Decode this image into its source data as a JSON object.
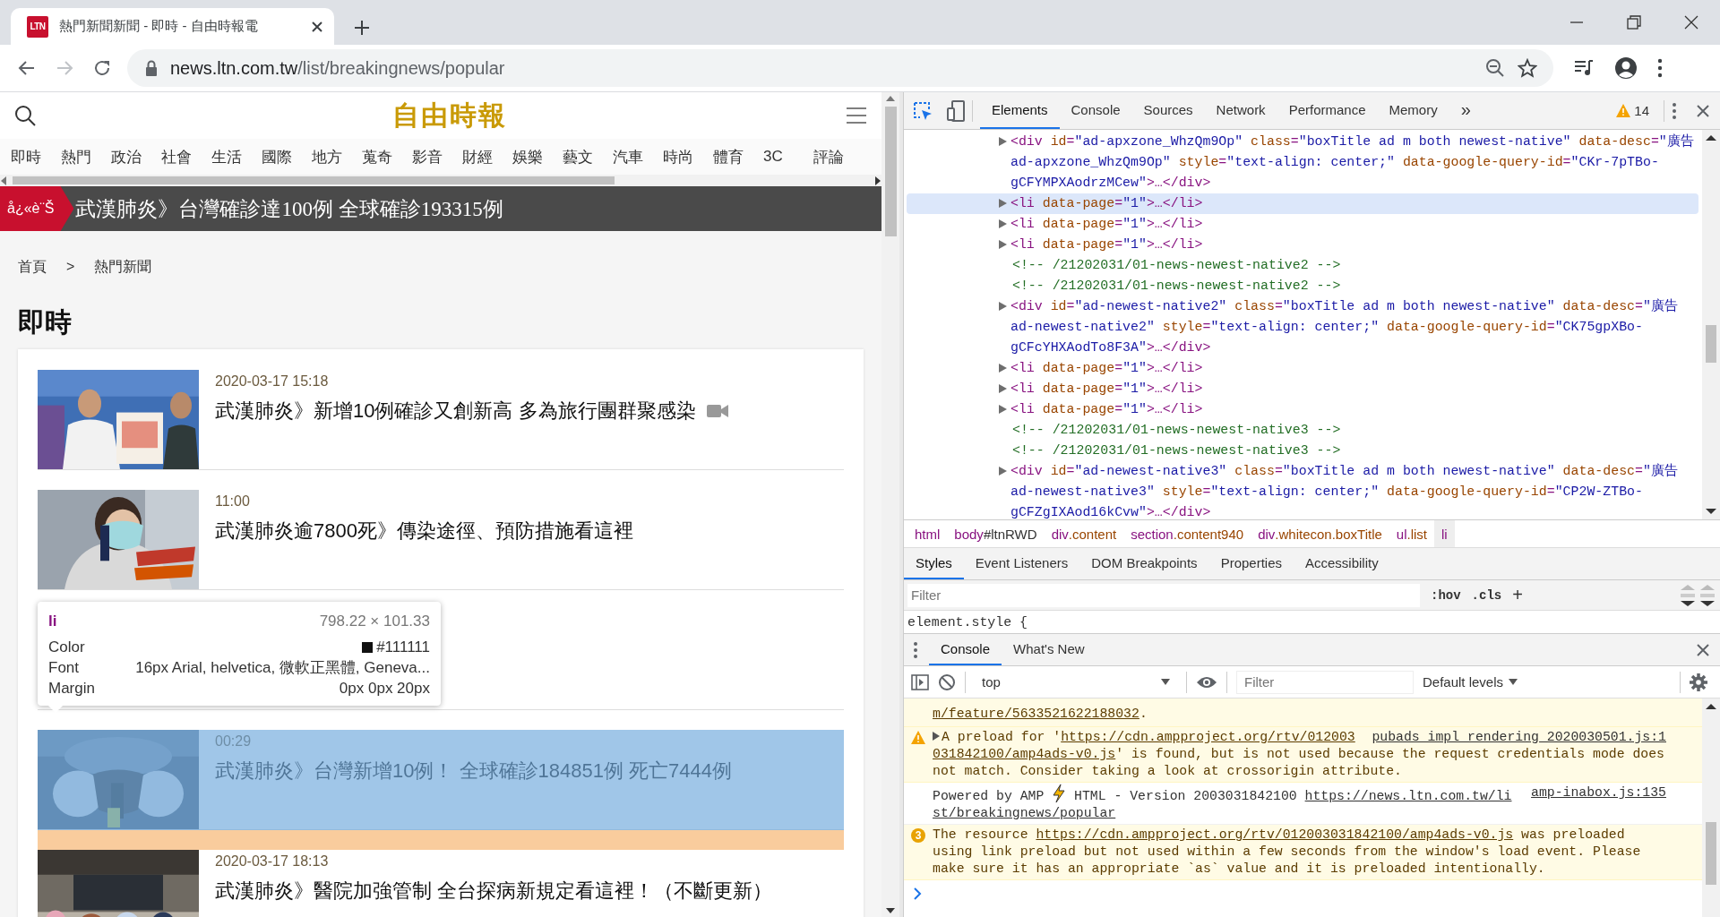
{
  "browser": {
    "favicon": "LTN",
    "tab_title": "熱門新聞新聞 - 即時 - 自由時報電",
    "url_host": "news.ltn.com.tw",
    "url_path": "/list/breakingnews/popular",
    "forward_disabled": true
  },
  "page": {
    "logo": "自由時報",
    "nav": [
      "即時",
      "熱門",
      "政治",
      "社會",
      "生活",
      "國際",
      "地方",
      "蒐奇",
      "影音",
      "財經",
      "娛樂",
      "藝文",
      "汽車",
      "時尚",
      "體育",
      "3C",
      "評論"
    ],
    "ticker": {
      "badge": "å¿«è¨Š",
      "text": "武漢肺炎》台灣確診達100例 全球確診193315例"
    },
    "breadcrumb": {
      "items": [
        "首頁",
        "熱門新聞"
      ],
      "separator": ">"
    },
    "heading": "即時",
    "articles": [
      {
        "kind": "story",
        "time": "2020-03-17 15:18",
        "title": "武漢肺炎》新增10例確診又創新高 多為旅行團群聚感染",
        "video": true,
        "inspected": false
      },
      {
        "kind": "story",
        "time": "11:00",
        "title": "武漢肺炎逾7800死》傳染途徑、預防措施看這裡",
        "video": false,
        "inspected": false
      },
      {
        "kind": "blank",
        "inspected": false
      },
      {
        "kind": "story",
        "time": "00:29",
        "title": "武漢肺炎》台灣新增10例！ 全球確診184851例 死亡7444例",
        "video": false,
        "inspected": true
      },
      {
        "kind": "story",
        "time": "2020-03-17 18:13",
        "title": "武漢肺炎》醫院加強管制 全台探病新規定看這裡！（不斷更新）",
        "video": false,
        "inspected": false
      }
    ]
  },
  "tooltip": {
    "tag": "li",
    "size": "798.22 × 101.33",
    "rows": [
      {
        "label": "Color",
        "value": "#111111",
        "color": "#111111"
      },
      {
        "label": "Font",
        "value": "16px Arial, helvetica, 微軟正黑體, Geneva..."
      },
      {
        "label": "Margin",
        "value": "0px 0px 20px"
      }
    ]
  },
  "devtools": {
    "inspect_active": true,
    "tabs": [
      {
        "label": "Elements",
        "selected": true
      },
      {
        "label": "Console",
        "selected": false
      },
      {
        "label": "Sources",
        "selected": false
      },
      {
        "label": "Network",
        "selected": false
      },
      {
        "label": "Performance",
        "selected": false
      },
      {
        "label": "Memory",
        "selected": false
      }
    ],
    "more": "»",
    "warnings": "14",
    "dom_lines": [
      {
        "kind": "element",
        "text": "<div id=\"ad-apxzone_WhzQm9Op\" class=\"boxTitle ad m both newest-native\" data-desc=\"廣告ad-apxzone_WhzQm9Op\" style=\"text-align: center;\" data-google-query-id=\"CKr-7pTBo-gCFYMPXAodrzMCew\">…</div>",
        "highlighted": false
      },
      {
        "kind": "element",
        "text": "<li data-page=\"1\">…</li>",
        "highlighted": true
      },
      {
        "kind": "element",
        "text": "<li data-page=\"1\">…</li>",
        "highlighted": false
      },
      {
        "kind": "element",
        "text": "<li data-page=\"1\">…</li>",
        "highlighted": false
      },
      {
        "kind": "comment",
        "text": "<!-- /21202031/01-news-newest-native2 -->",
        "highlighted": false
      },
      {
        "kind": "comment",
        "text": "<!-- /21202031/01-news-newest-native2 -->",
        "highlighted": false
      },
      {
        "kind": "element",
        "text": "<div id=\"ad-newest-native2\" class=\"boxTitle ad m both newest-native\" data-desc=\"廣告ad-newest-native2\" style=\"text-align: center;\" data-google-query-id=\"CK75gpXBo-gCFcYHXAodTo8F3A\">…</div>",
        "highlighted": false
      },
      {
        "kind": "element",
        "text": "<li data-page=\"1\">…</li>",
        "highlighted": false
      },
      {
        "kind": "element",
        "text": "<li data-page=\"1\">…</li>",
        "highlighted": false
      },
      {
        "kind": "element",
        "text": "<li data-page=\"1\">…</li>",
        "highlighted": false
      },
      {
        "kind": "comment",
        "text": "<!-- /21202031/01-news-newest-native3 -->",
        "highlighted": false
      },
      {
        "kind": "comment",
        "text": "<!-- /21202031/01-news-newest-native3 -->",
        "highlighted": false
      },
      {
        "kind": "element",
        "text": "<div id=\"ad-newest-native3\" class=\"boxTitle ad m both newest-native\" data-desc=\"廣告ad-newest-native3\" style=\"text-align: center;\" data-google-query-id=\"CP2W-ZTBo-gCFZgIXAod16kCvw\">…</div>",
        "highlighted": false
      }
    ],
    "breadcrumbs": [
      {
        "tag": "html",
        "selected": false
      },
      {
        "tag": "body",
        "suffix": "#ltnRWD",
        "kind": "id",
        "selected": false
      },
      {
        "tag": "div",
        "suffix": ".content",
        "kind": "class",
        "selected": false
      },
      {
        "tag": "section",
        "suffix": ".content940",
        "kind": "class",
        "selected": false
      },
      {
        "tag": "div",
        "suffix": ".whitecon.boxTitle",
        "kind": "class",
        "selected": false
      },
      {
        "tag": "ul",
        "suffix": ".list",
        "kind": "class",
        "selected": false
      },
      {
        "tag": "li",
        "selected": true
      }
    ],
    "subtabs": [
      {
        "label": "Styles",
        "selected": true
      },
      {
        "label": "Event Listeners",
        "selected": false
      },
      {
        "label": "DOM Breakpoints",
        "selected": false
      },
      {
        "label": "Properties",
        "selected": false
      },
      {
        "label": "Accessibility",
        "selected": false
      }
    ],
    "styles_filter": {
      "placeholder": "Filter"
    },
    "hov": ":hov",
    "cls": ".cls",
    "plus": "+",
    "style_rule": "element.style {",
    "drawer_tabs": [
      {
        "label": "Console",
        "selected": true
      },
      {
        "label": "What's New",
        "selected": false
      }
    ],
    "console_context": "top",
    "console_filter": {
      "placeholder": "Filter"
    },
    "levels": "Default levels",
    "messages": [
      {
        "kind": "warning-continued",
        "lines": [
          [
            {
              "kind": "link",
              "text": "m/feature/5633521622188032"
            },
            {
              "kind": "text",
              "text": "."
            }
          ]
        ]
      },
      {
        "kind": "warning",
        "expandable": true,
        "source": "pubads_impl_rendering_2020030501.js:1",
        "lines": [
          [
            {
              "kind": "text",
              "text": "A preload for '"
            },
            {
              "kind": "link",
              "text": "https://cdn.ampproject.org/rtv/012003"
            }
          ],
          [
            {
              "kind": "link",
              "text": "031842100/amp4ads-v0.js"
            },
            {
              "kind": "text",
              "text": "' is found, but is not used because the request credentials mode does"
            }
          ],
          [
            {
              "kind": "text",
              "text": "not match. Consider taking a look at crossorigin attribute."
            }
          ]
        ]
      },
      {
        "kind": "info",
        "source": "amp-inabox.js:135",
        "lines": [
          [
            {
              "kind": "text",
              "text": "Powered by AMP "
            },
            {
              "kind": "bolt"
            },
            {
              "kind": "text",
              "text": " HTML - Version 2003031842100 "
            },
            {
              "kind": "link",
              "text": "https://news.ltn.com.tw/li"
            }
          ],
          [
            {
              "kind": "link",
              "text": "st/breakingnews/popular"
            }
          ]
        ]
      },
      {
        "kind": "warning",
        "repeat": "3",
        "lines": [
          [
            {
              "kind": "text",
              "text": "The resource "
            },
            {
              "kind": "link",
              "text": "https://cdn.ampproject.org/rtv/012003031842100/amp4ads-v0.js"
            },
            {
              "kind": "text",
              "text": " was preloaded"
            }
          ],
          [
            {
              "kind": "text",
              "text": "using link preload but not used within a few seconds from the window's load event. Please"
            }
          ],
          [
            {
              "kind": "text",
              "text": "make sure it has an appropriate `as` value and it is preloaded intentionally."
            }
          ]
        ]
      }
    ]
  }
}
